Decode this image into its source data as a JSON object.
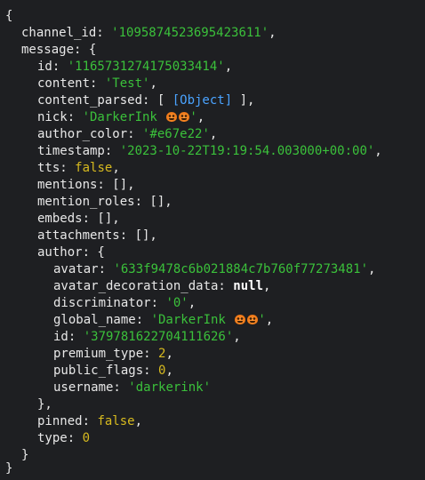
{
  "console": {
    "open_brace": "{",
    "close_brace": "}",
    "channel_id": {
      "key": "channel_id: ",
      "value": "'1095874523695423611'",
      "suffix": ","
    },
    "message_open": "message: {",
    "message": {
      "id": {
        "key": "id: ",
        "value": "'1165731274175033414'",
        "suffix": ","
      },
      "content": {
        "key": "content: ",
        "value": "'Test'",
        "suffix": ","
      },
      "content_parsed": {
        "key": "content_parsed: [ ",
        "value": "[Object]",
        "suffix": " ],"
      },
      "nick": {
        "key": "nick: ",
        "value": "'DarkerInk",
        "value_end": "'",
        "suffix": ","
      },
      "author_color": {
        "key": "author_color: ",
        "value": "'#e67e22'",
        "suffix": ","
      },
      "timestamp": {
        "key": "timestamp: ",
        "value": "'2023-10-22T19:19:54.003000+00:00'",
        "suffix": ","
      },
      "tts": {
        "key": "tts: ",
        "value": "false",
        "suffix": ","
      },
      "mentions": {
        "text": "mentions: [],"
      },
      "mention_roles": {
        "text": "mention_roles: [],"
      },
      "embeds": {
        "text": "embeds: [],"
      },
      "attachments": {
        "text": "attachments: [],"
      },
      "author_open": "author: {",
      "author": {
        "avatar": {
          "key": "avatar: ",
          "value": "'633f9478c6b021884c7b760f77273481'",
          "suffix": ","
        },
        "avatar_decoration_data": {
          "key": "avatar_decoration_data: ",
          "value": "null",
          "suffix": ","
        },
        "discriminator": {
          "key": "discriminator: ",
          "value": "'0'",
          "suffix": ","
        },
        "global_name": {
          "key": "global_name: ",
          "value": "'DarkerInk",
          "value_end": "'",
          "suffix": ","
        },
        "id": {
          "key": "id: ",
          "value": "'379781622704111626'",
          "suffix": ","
        },
        "premium_type": {
          "key": "premium_type: ",
          "value": "2",
          "suffix": ","
        },
        "public_flags": {
          "key": "public_flags: ",
          "value": "0",
          "suffix": ","
        },
        "username": {
          "key": "username: ",
          "value": "'darkerink'",
          "suffix": ""
        }
      },
      "author_close": "},",
      "pinned": {
        "key": "pinned: ",
        "value": "false",
        "suffix": ","
      },
      "type": {
        "key": "type: ",
        "value": "0",
        "suffix": ""
      }
    },
    "message_close": "}"
  },
  "colors": {
    "background": "#1e1f22",
    "text": "#e8e8e8",
    "string": "#3bc13b",
    "number_boolean": "#d7ba1f",
    "object_ref": "#4aa3ff"
  },
  "icons": {
    "nick_emoji": "pumpkin-icon",
    "global_name_emoji": "pumpkin-icon"
  }
}
